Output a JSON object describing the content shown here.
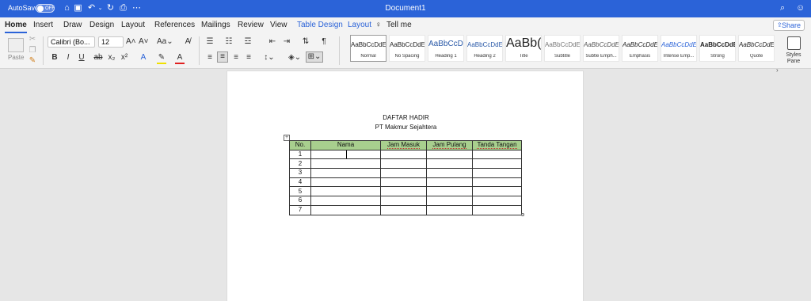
{
  "titlebar": {
    "autosave_label": "AutoSave",
    "autosave_state": "OFF",
    "document_title": "Document1"
  },
  "tabs": [
    "Home",
    "Insert",
    "Draw",
    "Design",
    "Layout",
    "References",
    "Mailings",
    "Review",
    "View",
    "Table Design",
    "Layout",
    "Tell me"
  ],
  "share_label": "Share",
  "ribbon": {
    "paste_label": "Paste",
    "font_name": "Calibri (Bo...",
    "font_size": "12",
    "styles": [
      {
        "sample": "AaBbCcDdEe",
        "name": "Normal"
      },
      {
        "sample": "AaBbCcDdEe",
        "name": "No Spacing"
      },
      {
        "sample": "AaBbCcDc",
        "name": "Heading 1"
      },
      {
        "sample": "AaBbCcDdEe",
        "name": "Heading 2"
      },
      {
        "sample": "AaBb(",
        "name": "Title"
      },
      {
        "sample": "AaBbCcDdEe",
        "name": "Subtitle"
      },
      {
        "sample": "AaBbCcDdEe",
        "name": "Subtle Emph..."
      },
      {
        "sample": "AaBbCcDdEe",
        "name": "Emphasis"
      },
      {
        "sample": "AaBbCcDdEe",
        "name": "Intense Emp..."
      },
      {
        "sample": "AaBbCcDdEe",
        "name": "Strong"
      },
      {
        "sample": "AaBbCcDdEe",
        "name": "Quote"
      }
    ],
    "styles_pane_label": "Styles Pane"
  },
  "document": {
    "heading_line1": "DAFTAR HADIR",
    "heading_line2": "PT Makmur Sejahtera",
    "table": {
      "headers": [
        "No.",
        "Nama",
        "Jam Masuk",
        "Jam Pulang",
        "Tanda Tangan"
      ],
      "rows": [
        [
          "1",
          "",
          "",
          "",
          ""
        ],
        [
          "2",
          "",
          "",
          "",
          ""
        ],
        [
          "3",
          "",
          "",
          "",
          ""
        ],
        [
          "4",
          "",
          "",
          "",
          ""
        ],
        [
          "5",
          "",
          "",
          "",
          ""
        ],
        [
          "6",
          "",
          "",
          "",
          ""
        ],
        [
          "7",
          "",
          "",
          "",
          ""
        ]
      ]
    }
  },
  "colors": {
    "titlebar": "#2b63d8",
    "header_fill": "#a8cf8e"
  }
}
